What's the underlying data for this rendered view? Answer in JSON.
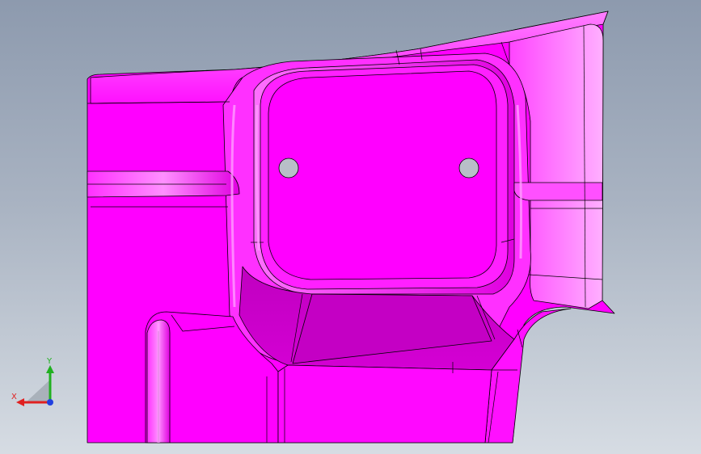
{
  "viewport": {
    "background_top": "#8d9aae",
    "background_bottom": "#d6dce3"
  },
  "model": {
    "part_color": "#ff00ff",
    "shade_color": "#d800d8",
    "dark_shade_color": "#b800b8",
    "highlight_color": "#ff66ff",
    "edge_color": "#000000",
    "hole_color": "#b8bfc8",
    "holes": 2
  },
  "triad": {
    "x_label": "X",
    "y_label": "Y",
    "x_color": "#e02020",
    "y_color": "#20b020",
    "z_color": "#2040e0"
  }
}
